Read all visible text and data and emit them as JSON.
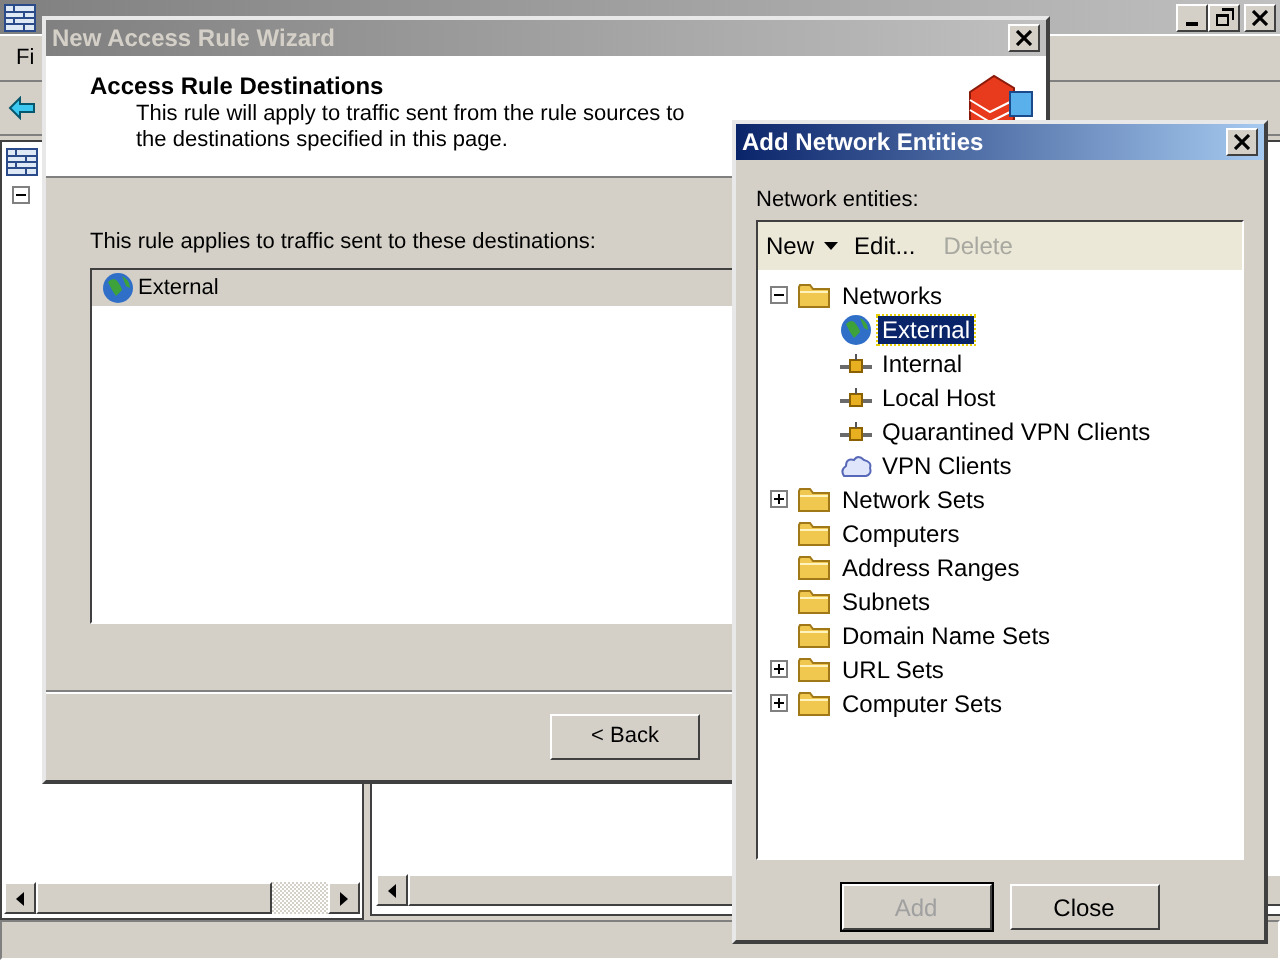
{
  "main_window": {
    "menu": [
      "Fi"
    ]
  },
  "wizard": {
    "title": "New Access Rule Wizard",
    "heading": "Access Rule Destinations",
    "description": "This rule will apply to traffic sent from the rule sources to the destinations specified in this page.",
    "list_label": "This rule applies to traffic sent to these destinations:",
    "destinations": [
      {
        "label": "External",
        "kind": "globe",
        "selected": true
      }
    ],
    "buttons": [
      "< Back"
    ]
  },
  "dialog": {
    "title": "Add Network Entities",
    "label": "Network entities:",
    "toolbar": [
      {
        "label": "New",
        "kind": "dropdown",
        "disabled": false
      },
      {
        "label": "Edit...",
        "kind": "button",
        "disabled": false
      },
      {
        "label": "Delete",
        "kind": "button",
        "disabled": true
      }
    ],
    "tree": [
      {
        "label": "Networks",
        "kind": "folder",
        "expandable": true,
        "expanded": true,
        "children": [
          {
            "label": "External",
            "kind": "globe",
            "selected": true
          },
          {
            "label": "Internal",
            "kind": "network",
            "selected": false
          },
          {
            "label": "Local Host",
            "kind": "network",
            "selected": false
          },
          {
            "label": "Quarantined VPN Clients",
            "kind": "network",
            "selected": false
          },
          {
            "label": "VPN Clients",
            "kind": "vpn",
            "selected": false
          }
        ]
      },
      {
        "label": "Network Sets",
        "kind": "folder",
        "expandable": true,
        "expanded": false
      },
      {
        "label": "Computers",
        "kind": "folder",
        "expandable": false
      },
      {
        "label": "Address Ranges",
        "kind": "folder",
        "expandable": false
      },
      {
        "label": "Subnets",
        "kind": "folder",
        "expandable": false
      },
      {
        "label": "Domain Name Sets",
        "kind": "folder",
        "expandable": false
      },
      {
        "label": "URL Sets",
        "kind": "folder",
        "expandable": true,
        "expanded": false
      },
      {
        "label": "Computer Sets",
        "kind": "folder",
        "expandable": true,
        "expanded": false
      }
    ],
    "buttons": [
      {
        "label": "Add",
        "disabled": true,
        "default": true
      },
      {
        "label": "Close",
        "disabled": false,
        "default": false
      }
    ]
  }
}
